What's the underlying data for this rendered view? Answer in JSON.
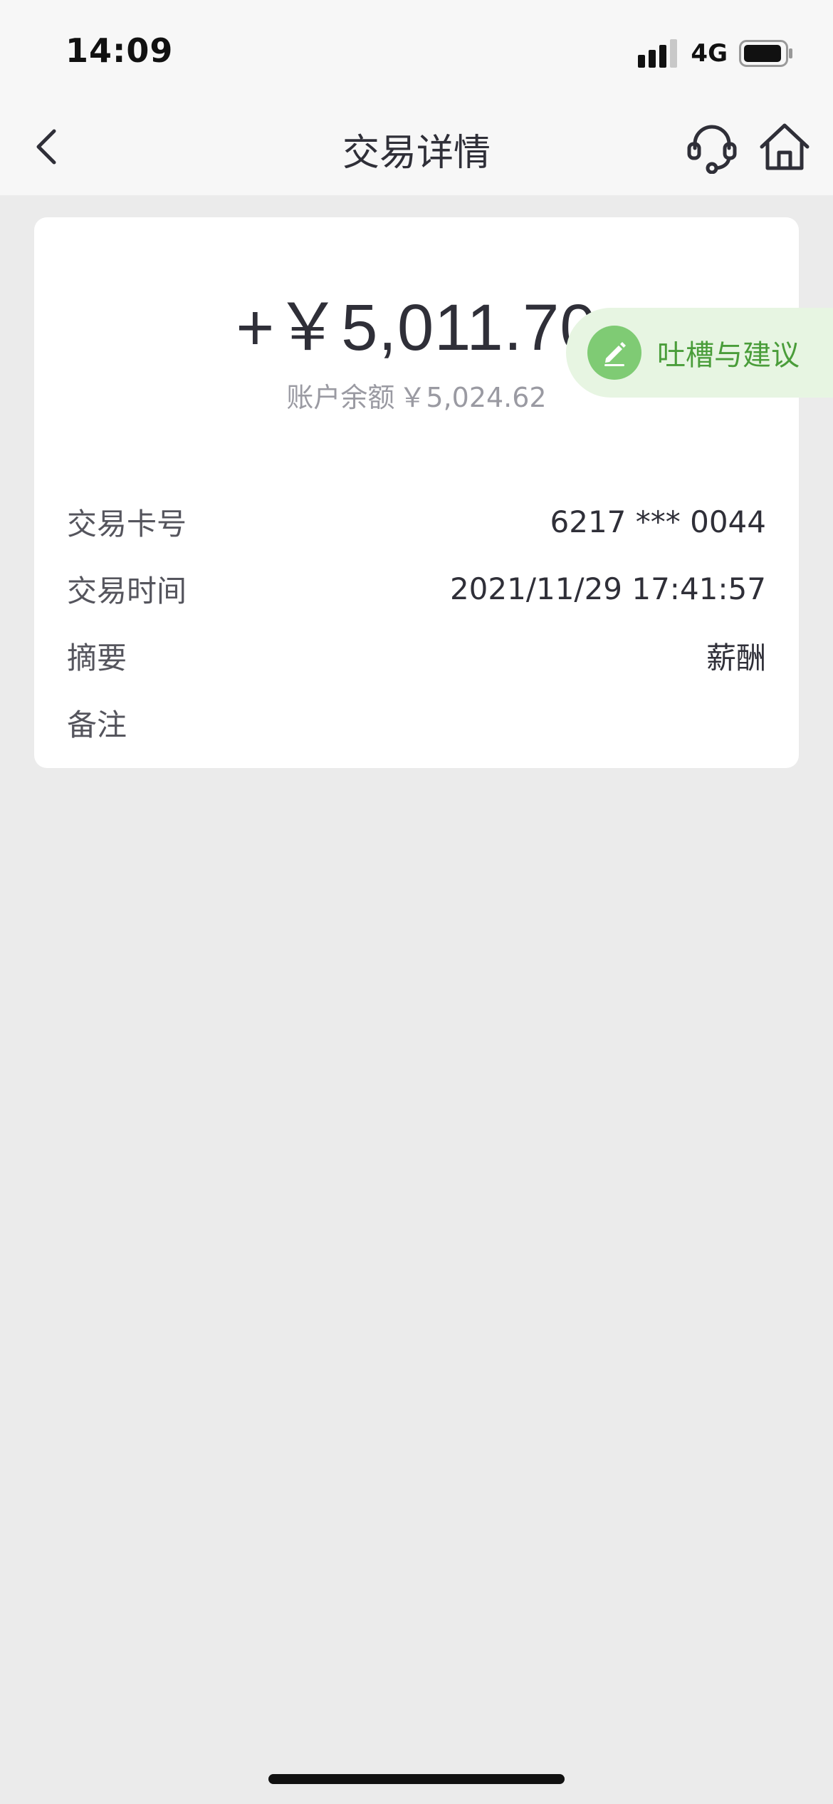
{
  "status_bar": {
    "time": "14:09",
    "network": "4G",
    "icons": [
      "signal-icon",
      "battery-icon"
    ]
  },
  "nav": {
    "title": "交易详情",
    "back_icon": "chevron-left-icon",
    "service_icon": "headset-icon",
    "home_icon": "home-icon"
  },
  "transaction": {
    "amount": "+￥5,011.70",
    "balance_label": "账户余额",
    "balance_value": "￥5,024.62",
    "details": [
      {
        "label": "交易卡号",
        "value": "6217 *** 0044"
      },
      {
        "label": "交易时间",
        "value": "2021/11/29 17:41:57"
      },
      {
        "label": "摘要",
        "value": "薪酬"
      },
      {
        "label": "备注",
        "value": ""
      }
    ]
  },
  "feedback": {
    "label": "吐槽与建议",
    "icon": "pencil-icon"
  },
  "colors": {
    "accent_green": "#4a9d3a",
    "feedback_bg": "#e7f5e2",
    "page_bg": "#ebebeb"
  }
}
